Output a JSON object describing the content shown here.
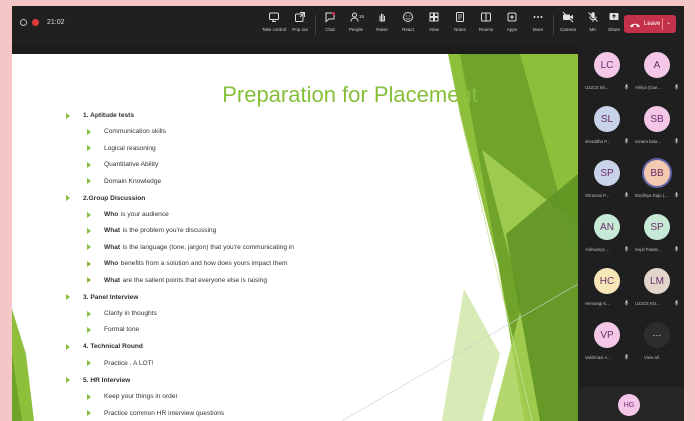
{
  "meeting": {
    "timer": "21:02",
    "toolbar": [
      {
        "label": "Take control",
        "icon": "take-control-icon"
      },
      {
        "label": "Pop out",
        "icon": "pop-out-icon"
      },
      {
        "label": "Chat",
        "icon": "chat-icon"
      },
      {
        "label": "People",
        "icon": "people-icon",
        "badge": "16"
      },
      {
        "label": "Raise",
        "icon": "raise-hand-icon"
      },
      {
        "label": "React",
        "icon": "react-icon"
      },
      {
        "label": "View",
        "icon": "view-icon"
      },
      {
        "label": "Notes",
        "icon": "notes-icon"
      },
      {
        "label": "Rooms",
        "icon": "rooms-icon"
      },
      {
        "label": "Apps",
        "icon": "apps-icon"
      },
      {
        "label": "More",
        "icon": "more-icon"
      },
      {
        "label": "Camera",
        "icon": "camera-icon"
      },
      {
        "label": "Mic",
        "icon": "mic-icon"
      },
      {
        "label": "Share",
        "icon": "share-icon"
      }
    ],
    "leave_label": "Leave",
    "leave_color": "#c4314b"
  },
  "slide": {
    "title": "Preparation for Placement",
    "accent": "#86bf3a",
    "items": [
      {
        "level": 1,
        "text": "1. Aptitude tests"
      },
      {
        "level": 2,
        "text": "Communication skills"
      },
      {
        "level": 2,
        "text": "Logical reasoning"
      },
      {
        "level": 2,
        "text": "Quantitative Ability"
      },
      {
        "level": 2,
        "text": "Domain Knowledge"
      },
      {
        "level": 1,
        "text": "2.Group Discussion"
      },
      {
        "level": 2,
        "em": "Who",
        "text": "is your audience"
      },
      {
        "level": 2,
        "em": "What",
        "text": "is the problem you're discussing"
      },
      {
        "level": 2,
        "em": "What",
        "text": "is the language (tone, jargon) that you're communicating in"
      },
      {
        "level": 2,
        "em": "Who",
        "text": "benefits from a solution and how does yours impact them"
      },
      {
        "level": 2,
        "em": "What",
        "text": "are the salient points that everyone else is raising"
      },
      {
        "level": 1,
        "text": "3. Panel Interview"
      },
      {
        "level": 2,
        "text": "Clarity in thoughts"
      },
      {
        "level": 2,
        "text": "Formal tone"
      },
      {
        "level": 1,
        "text": "4. Technical Round"
      },
      {
        "level": 2,
        "text": "Practice . A LOT!"
      },
      {
        "level": 1,
        "text": "5. HR Interview"
      },
      {
        "level": 2,
        "text": "Keep your things in order"
      },
      {
        "level": 2,
        "text": "Practice common HR interview questions"
      }
    ]
  },
  "participants": [
    {
      "initials": "LC",
      "name": "U22CE Mi...",
      "color": "#f4c6e8"
    },
    {
      "initials": "A",
      "name": "Ahilya (Gue...",
      "color": "#f4c6e8"
    },
    {
      "initials": "SL",
      "name": "shraddha P...",
      "color": "#c8d2e8"
    },
    {
      "initials": "SB",
      "name": "sonam bala...",
      "color": "#f4c6e8"
    },
    {
      "initials": "SP",
      "name": "Shravani P...",
      "color": "#c8d2e8"
    },
    {
      "initials": "BB",
      "name": "Bindhiya Raju (...",
      "color": "#f3c9b0",
      "speaking": true
    },
    {
      "initials": "AN",
      "name": "Aishwarya ...",
      "color": "#c6ead6"
    },
    {
      "initials": "SP",
      "name": "Sejal Pawar...",
      "color": "#c6ead6"
    },
    {
      "initials": "HC",
      "name": "Hemangi K...",
      "color": "#f6e7b8"
    },
    {
      "initials": "LM",
      "name": "U22CE KO...",
      "color": "#e2d6cc"
    },
    {
      "initials": "VP",
      "name": "Vaishnavi A...",
      "color": "#f4c6e8"
    }
  ],
  "view_all": {
    "label": "View all",
    "icon": "more-icon"
  },
  "self": {
    "initials": "HG",
    "color": "#f4c6e8"
  }
}
